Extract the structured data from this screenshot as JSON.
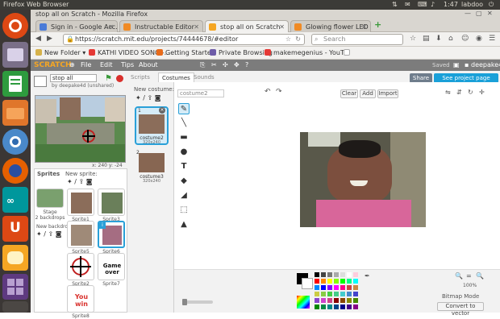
{
  "os": {
    "window_title": "Firefox Web Browser",
    "time": "1:47",
    "user": "labdoo"
  },
  "launcher": {
    "icons": [
      "ubuntu-icon",
      "system-icon",
      "calc-icon",
      "files-icon",
      "chromium-icon",
      "firefox-icon",
      "arduino-icon",
      "ubuntu-one-icon",
      "scratch-icon",
      "workspace-icon",
      "trash-icon"
    ]
  },
  "browser": {
    "page_title": "stop all on Scratch - Mozilla Firefox",
    "tabs": [
      {
        "label": "Sign in - Google Acc...",
        "color": "#4a7bd8"
      },
      {
        "label": "Instructable Editor",
        "color": "#f08a24"
      },
      {
        "label": "stop all on Scratch",
        "color": "#f5a623"
      },
      {
        "label": "Glowing flower LED",
        "color": "#f08a24"
      }
    ],
    "url": "https://scratch.mit.edu/projects/74444678/#editor",
    "search_placeholder": "Search",
    "bookmarks": [
      {
        "label": "New Folder",
        "color": "#d6b24a"
      },
      {
        "label": "KATHI VIDEO SONG -...",
        "color": "#e53935"
      },
      {
        "label": "Getting Started",
        "color": "#e86b1a"
      },
      {
        "label": "Private Browsing",
        "color": "#6e5ca8"
      },
      {
        "label": "makemegenius - YouT...",
        "color": "#e53935"
      }
    ]
  },
  "scratch": {
    "logo": "SCRATCH",
    "menu": [
      "File",
      "Edit",
      "Tips",
      "About"
    ],
    "saved_label": "Saved",
    "username": "deepake4d",
    "share_label": "Share",
    "see_project_label": "See project page",
    "project_title": "stop all",
    "project_author": "by deepake4d (unshared)",
    "stage_coords": {
      "x_label": "x:",
      "x_value": "240",
      "y_label": "y:",
      "y_value": "-24"
    },
    "sprites_header": "Sprites",
    "new_sprite_label": "New sprite:",
    "stage_label": "Stage",
    "stage_backdrops": "2 backdrops",
    "new_backdrop_label": "New backdrop:",
    "sprites": [
      {
        "name": "Sprite1"
      },
      {
        "name": "Sprite3"
      },
      {
        "name": "Sprite5"
      },
      {
        "name": "Sprite6"
      },
      {
        "name": "Sprite2"
      },
      {
        "name": "Sprite7"
      },
      {
        "name": "Sprite8"
      }
    ],
    "sprite_texts": {
      "game_over": "Game over",
      "you_win": "You win"
    },
    "tabs": [
      "Scripts",
      "Costumes",
      "Sounds"
    ],
    "active_tab": "Costumes",
    "new_costume_label": "New costume:",
    "costumes": [
      {
        "index": "1",
        "name": "costume2",
        "size": "320x240"
      },
      {
        "index": "2",
        "name": "costume3",
        "size": "320x240"
      }
    ],
    "costume_name_value": "costume2",
    "editor_buttons": [
      "Clear",
      "Add",
      "Import"
    ],
    "zoom_label": "100%",
    "mode_label": "Bitmap Mode",
    "convert_label": "Convert to vector"
  }
}
